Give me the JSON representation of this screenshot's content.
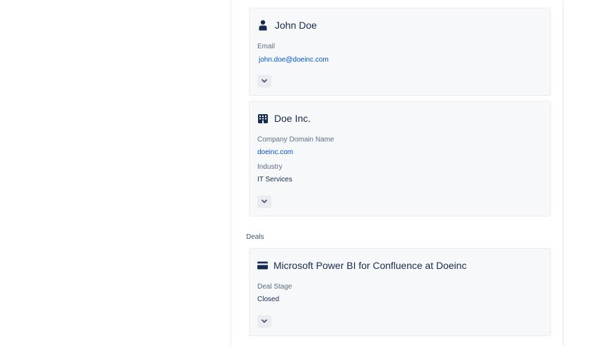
{
  "contact": {
    "name": "John Doe",
    "icon": "person-icon",
    "email_label": "Email",
    "email": "john.doe@doeinc.com"
  },
  "company": {
    "name": "Doe Inc.",
    "icon": "building-icon",
    "domain_label": "Company Domain Name",
    "domain": "doeinc.com",
    "industry_label": "Industry",
    "industry": "IT Services"
  },
  "deals": {
    "heading": "Deals",
    "items": [
      {
        "title": "Microsoft Power BI for Confluence at Doeinc",
        "icon": "credit-card-icon",
        "stage_label": "Deal Stage",
        "stage": "Closed"
      }
    ]
  },
  "colors": {
    "link": "#0052cc",
    "text": "#172b4d",
    "label": "#5e6c84",
    "card_bg": "#f7f8f9"
  }
}
